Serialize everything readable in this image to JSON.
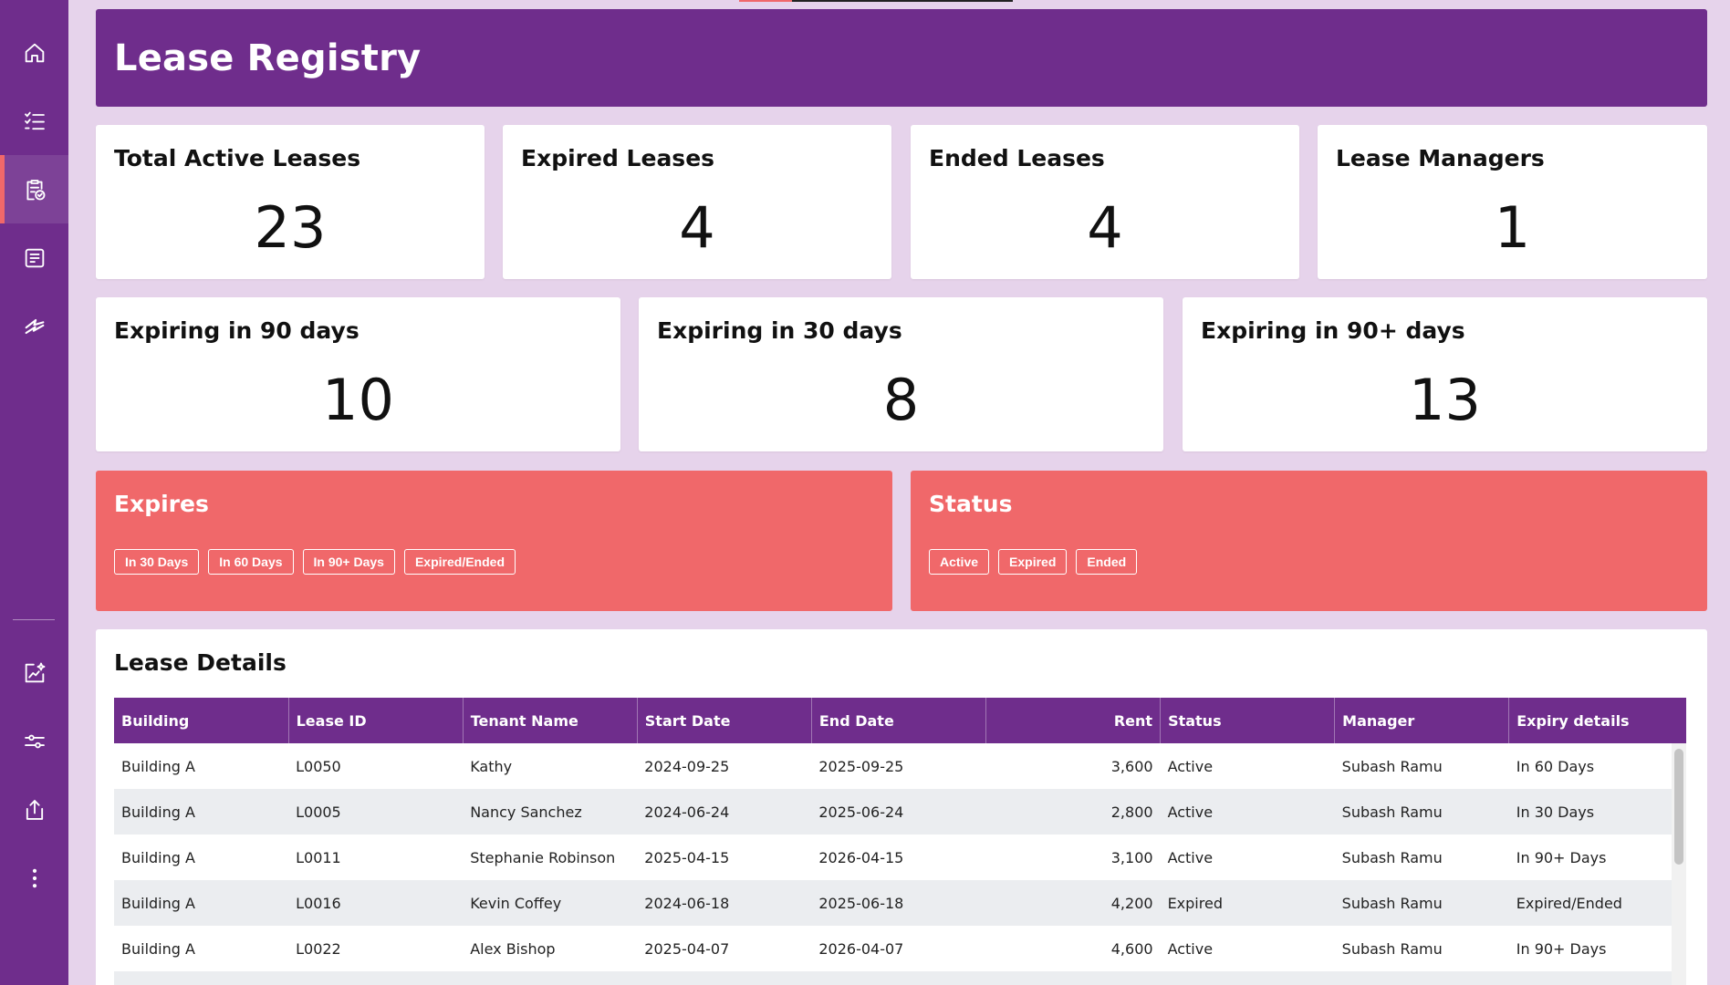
{
  "header": {
    "title": "Lease Registry"
  },
  "sidebar": {
    "items": [
      {
        "icon": "home-icon"
      },
      {
        "icon": "checklist-icon"
      },
      {
        "icon": "clipboard-check-icon",
        "active": true
      },
      {
        "icon": "document-list-icon"
      },
      {
        "icon": "lightning-icon"
      },
      {
        "icon": "chart-sparkle-icon"
      },
      {
        "icon": "sliders-icon"
      },
      {
        "icon": "share-icon"
      },
      {
        "icon": "more-vertical-icon"
      }
    ]
  },
  "kpis": {
    "total_active": {
      "label": "Total Active Leases",
      "value": "23"
    },
    "expired": {
      "label": "Expired Leases",
      "value": "4"
    },
    "ended": {
      "label": "Ended Leases",
      "value": "4"
    },
    "managers": {
      "label": "Lease Managers",
      "value": "1"
    },
    "exp90": {
      "label": "Expiring in 90 days",
      "value": "10"
    },
    "exp30": {
      "label": "Expiring in 30 days",
      "value": "8"
    },
    "exp90plus": {
      "label": "Expiring in 90+ days",
      "value": "13"
    }
  },
  "filters": {
    "expires": {
      "title": "Expires",
      "options": [
        "In 30 Days",
        "In 60 Days",
        "In 90+ Days",
        "Expired/Ended"
      ]
    },
    "status": {
      "title": "Status",
      "options": [
        "Active",
        "Expired",
        "Ended"
      ]
    }
  },
  "details": {
    "title": "Lease Details",
    "columns": [
      "Building",
      "Lease ID",
      "Tenant Name",
      "Start Date",
      "End Date",
      "Rent",
      "Status",
      "Manager",
      "Expiry details"
    ],
    "rows": [
      [
        "Building A",
        "L0050",
        "Kathy",
        "2024-09-25",
        "2025-09-25",
        "3,600",
        "Active",
        "Subash Ramu",
        "In 60 Days"
      ],
      [
        "Building A",
        "L0005",
        "Nancy Sanchez",
        "2024-06-24",
        "2025-06-24",
        "2,800",
        "Active",
        "Subash Ramu",
        "In 30 Days"
      ],
      [
        "Building A",
        "L0011",
        "Stephanie Robinson",
        "2025-04-15",
        "2026-04-15",
        "3,100",
        "Active",
        "Subash Ramu",
        "In 90+ Days"
      ],
      [
        "Building A",
        "L0016",
        "Kevin Coffey",
        "2024-06-18",
        "2025-06-18",
        "4,200",
        "Expired",
        "Subash Ramu",
        "Expired/Ended"
      ],
      [
        "Building A",
        "L0022",
        "Alex Bishop",
        "2025-04-07",
        "2026-04-07",
        "4,600",
        "Active",
        "Subash Ramu",
        "In 90+ Days"
      ],
      [
        "",
        "",
        "",
        "",
        "",
        "",
        "",
        "",
        ""
      ]
    ]
  },
  "colors": {
    "brand_purple": "#6f2d8c",
    "accent_coral": "#f0686a",
    "page_bg": "#e6d3eb"
  }
}
